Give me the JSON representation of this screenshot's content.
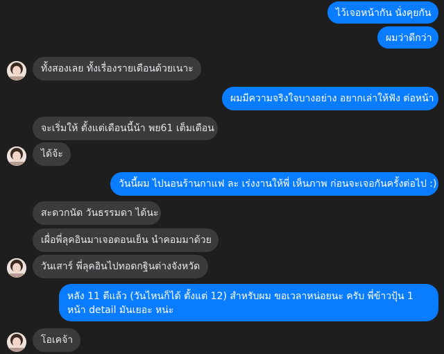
{
  "messages": [
    {
      "text": "ไว้เจอหน้ากัน นั่งคุยกัน"
    },
    {
      "text": "ผมว่าดีกว่า"
    },
    {
      "text": "ทั้งสองเลย ทั้งเรื่องรายเดือนด้วยเนาะ"
    },
    {
      "text": "ผมมีความจริงใจบางอย่าง อยากเล่าให้ฟัง ต่อหน้า"
    },
    {
      "text": "จะเริ่มให้ ตั้งแต่เดือนนี้น้า พย61 เต็มเดือน"
    },
    {
      "text": "ได้จ้ะ"
    },
    {
      "text": "วันนี้ผม ไปนอนร้านกาแฟ ละ เร่งงานให้พี่ เห็นภาพ ก่อนจะเจอกันครั้งต่อไป :)"
    },
    {
      "text": "สะดวกนัด วันธรรมดา ได้นะ"
    },
    {
      "text": "เผื่อพี่ลุคอินมาเจอตอนเย็น นำคอมมาด้วย"
    },
    {
      "text": "วันเสาร์ พี่ลุคอินไปทอดกฐินต่างจังหวัด"
    },
    {
      "text": "หลัง 11 ตีแล้ว (วันไหนก็ได้ ตั้งแต่ 12) สำหรับผม ขอเวลาหน่อยนะ ครับ พี่ข้าวปุ้น 1 หน้า detail มันเยอะ หน่ะ"
    },
    {
      "text": "โอเคจ้า"
    }
  ],
  "colors": {
    "background": "#1e1e1e",
    "outgoing_bubble": "#0a7cff",
    "incoming_bubble": "#3a3b3c",
    "outgoing_text": "#ffffff",
    "incoming_text": "#e4e6eb"
  },
  "icons": {
    "avatar": "contact-avatar-icon"
  }
}
